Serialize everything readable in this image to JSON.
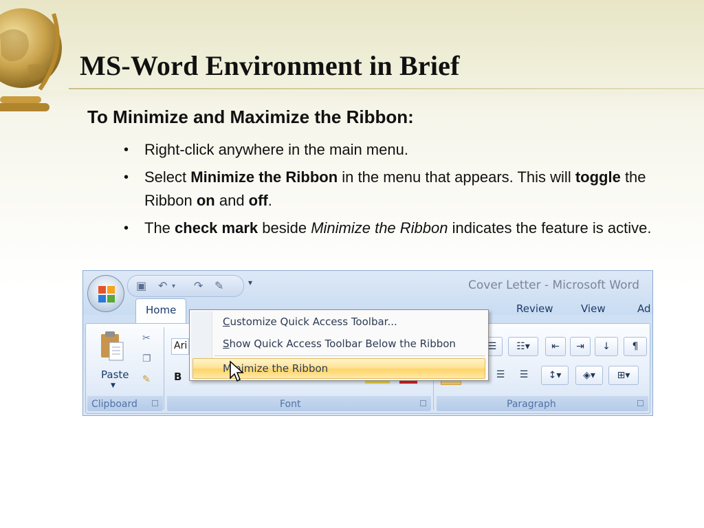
{
  "slide": {
    "title": "MS-Word Environment in Brief",
    "subtitle": "To Minimize and Maximize the Ribbon:",
    "bullets": [
      {
        "text": "Right-click anywhere in the main menu."
      },
      {
        "p1": "Select ",
        "b1": "Minimize the Ribbon",
        "p2": " in the menu that appears. This will ",
        "b2": "toggle",
        "p3": " the Ribbon ",
        "b3": "on",
        "p4": " and ",
        "b4": "off",
        "p5": "."
      },
      {
        "p1": "The ",
        "b1": "check mark",
        "p2": " beside ",
        "i1": "Minimize the Ribbon",
        "p3": " indicates the feature is active."
      }
    ]
  },
  "word": {
    "window_title": "Cover Letter - Microsoft Word",
    "tabs": {
      "home": "Home",
      "review": "Review",
      "view": "View",
      "add_ins": "Ad"
    },
    "font_box": "Ari",
    "bold_glyph": "B",
    "groups": {
      "clipboard": "Clipboard",
      "font": "Font",
      "paragraph": "Paragraph"
    },
    "paste_label": "Paste",
    "menu": {
      "item1_rest": "ustomize Quick Access Toolbar...",
      "item1_key": "C",
      "item2_key": "S",
      "item2_rest": "how Quick Access Toolbar Below the Ribbon",
      "item3_pre": "M",
      "item3_key": "i",
      "item3_rest": "nimize the Ribbon"
    },
    "icons": [
      "office-button-icon",
      "save-icon",
      "undo-icon",
      "redo-icon",
      "customize-icon",
      "paste-icon",
      "cut-icon",
      "copy-icon",
      "format-painter-icon",
      "cursor-icon"
    ]
  }
}
